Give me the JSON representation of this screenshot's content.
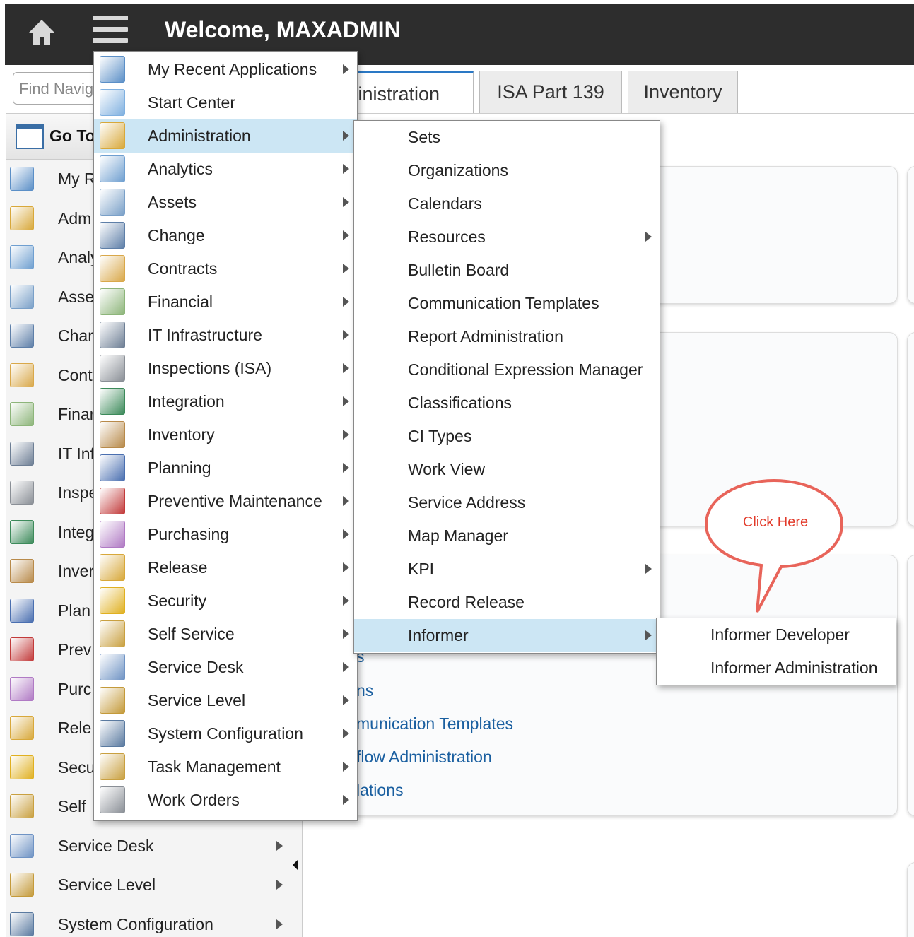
{
  "header": {
    "welcome": "Welcome, MAXADMIN",
    "home_icon": "home-icon",
    "menu_icon": "hamburger-menu-icon"
  },
  "nav": {
    "find_placeholder": "Find Navig",
    "goto_label": "Go To",
    "background_items": [
      {
        "label": "My R",
        "icon": "recent-apps-icon",
        "color": "#5b8fc7"
      },
      {
        "label": "Adm",
        "icon": "administration-icon",
        "color": "#d8a83a"
      },
      {
        "label": "Analy",
        "icon": "analytics-icon",
        "color": "#6f9fd0"
      },
      {
        "label": "Asse",
        "icon": "assets-icon",
        "color": "#7aa0c8"
      },
      {
        "label": "Char",
        "icon": "change-icon",
        "color": "#5e7fa8"
      },
      {
        "label": "Cont",
        "icon": "contracts-icon",
        "color": "#d9a84a"
      },
      {
        "label": "Finar",
        "icon": "financial-icon",
        "color": "#8db57a"
      },
      {
        "label": "IT Inf",
        "icon": "it-infrastructure-icon",
        "color": "#6d7e94"
      },
      {
        "label": "Inspe",
        "icon": "inspections-icon",
        "color": "#8a8f96"
      },
      {
        "label": "Integ",
        "icon": "integration-icon",
        "color": "#3c8a5a"
      },
      {
        "label": "Inver",
        "icon": "inventory-icon",
        "color": "#b88a4a"
      },
      {
        "label": "Plan",
        "icon": "planning-icon",
        "color": "#4a6fb0"
      },
      {
        "label": "Prev",
        "icon": "preventive-maintenance-icon",
        "color": "#c23a3a"
      },
      {
        "label": "Purc",
        "icon": "purchasing-icon",
        "color": "#b07ac4"
      },
      {
        "label": "Rele",
        "icon": "release-icon",
        "color": "#d8a83a"
      },
      {
        "label": "Secu",
        "icon": "security-icon",
        "color": "#e0b020"
      },
      {
        "label": "Self",
        "icon": "self-service-icon",
        "color": "#c9a040"
      },
      {
        "label": "Service Desk",
        "icon": "service-desk-icon",
        "color": "#6f93c4"
      },
      {
        "label": "Service Level",
        "icon": "service-level-icon",
        "color": "#c49a3a"
      },
      {
        "label": "System Configuration",
        "icon": "system-configuration-icon",
        "color": "#5a7aa0"
      }
    ]
  },
  "tabs": [
    {
      "label": "lministration"
    },
    {
      "label": "ISA Part 139"
    },
    {
      "label": "Inventory"
    }
  ],
  "cards": {
    "links": [
      "s",
      "ns",
      "munication Templates",
      "flow Administration",
      "lations"
    ]
  },
  "main_menu": {
    "items": [
      {
        "label": "My Recent Applications",
        "icon": "recent-apps-icon",
        "color": "#5b8fc7",
        "arrow": true
      },
      {
        "label": "Start Center",
        "icon": "start-center-icon",
        "color": "#7fb0e0",
        "arrow": false
      },
      {
        "label": "Administration",
        "icon": "administration-icon",
        "color": "#d8a83a",
        "arrow": true
      },
      {
        "label": "Analytics",
        "icon": "analytics-icon",
        "color": "#6f9fd0",
        "arrow": true
      },
      {
        "label": "Assets",
        "icon": "assets-icon",
        "color": "#7aa0c8",
        "arrow": true
      },
      {
        "label": "Change",
        "icon": "change-icon",
        "color": "#5e7fa8",
        "arrow": true
      },
      {
        "label": "Contracts",
        "icon": "contracts-icon",
        "color": "#d9a84a",
        "arrow": true
      },
      {
        "label": "Financial",
        "icon": "financial-icon",
        "color": "#8db57a",
        "arrow": true
      },
      {
        "label": "IT Infrastructure",
        "icon": "it-infrastructure-icon",
        "color": "#6d7e94",
        "arrow": true
      },
      {
        "label": "Inspections (ISA)",
        "icon": "inspections-icon",
        "color": "#8a8f96",
        "arrow": true
      },
      {
        "label": "Integration",
        "icon": "integration-icon",
        "color": "#3c8a5a",
        "arrow": true
      },
      {
        "label": "Inventory",
        "icon": "inventory-icon",
        "color": "#b88a4a",
        "arrow": true
      },
      {
        "label": "Planning",
        "icon": "planning-icon",
        "color": "#4a6fb0",
        "arrow": true
      },
      {
        "label": "Preventive Maintenance",
        "icon": "preventive-maintenance-icon",
        "color": "#c23a3a",
        "arrow": true
      },
      {
        "label": "Purchasing",
        "icon": "purchasing-icon",
        "color": "#b07ac4",
        "arrow": true
      },
      {
        "label": "Release",
        "icon": "release-icon",
        "color": "#d8a83a",
        "arrow": true
      },
      {
        "label": "Security",
        "icon": "security-icon",
        "color": "#e0b020",
        "arrow": true
      },
      {
        "label": "Self Service",
        "icon": "self-service-icon",
        "color": "#c9a040",
        "arrow": true
      },
      {
        "label": "Service Desk",
        "icon": "service-desk-icon",
        "color": "#6f93c4",
        "arrow": true
      },
      {
        "label": "Service Level",
        "icon": "service-level-icon",
        "color": "#c49a3a",
        "arrow": true
      },
      {
        "label": "System Configuration",
        "icon": "system-configuration-icon",
        "color": "#5a7aa0",
        "arrow": true
      },
      {
        "label": "Task Management",
        "icon": "task-management-icon",
        "color": "#c9a040",
        "arrow": true
      },
      {
        "label": "Work Orders",
        "icon": "work-orders-icon",
        "color": "#8a8f96",
        "arrow": true
      }
    ]
  },
  "admin_menu": {
    "items": [
      {
        "label": "Sets",
        "arrow": false
      },
      {
        "label": "Organizations",
        "arrow": false
      },
      {
        "label": "Calendars",
        "arrow": false
      },
      {
        "label": "Resources",
        "arrow": true
      },
      {
        "label": "Bulletin Board",
        "arrow": false
      },
      {
        "label": "Communication Templates",
        "arrow": false
      },
      {
        "label": "Report Administration",
        "arrow": false
      },
      {
        "label": "Conditional Expression Manager",
        "arrow": false
      },
      {
        "label": "Classifications",
        "arrow": false
      },
      {
        "label": "CI Types",
        "arrow": false
      },
      {
        "label": "Work View",
        "arrow": false
      },
      {
        "label": "Service Address",
        "arrow": false
      },
      {
        "label": "Map Manager",
        "arrow": false
      },
      {
        "label": "KPI",
        "arrow": true
      },
      {
        "label": "Record Release",
        "arrow": false
      },
      {
        "label": "Informer",
        "arrow": true
      }
    ]
  },
  "informer_menu": {
    "items": [
      {
        "label": "Informer Developer"
      },
      {
        "label": "Informer Administration"
      }
    ]
  },
  "callout": {
    "text": "Click Here",
    "color": "#e23a2a"
  },
  "colors": {
    "topbar": "#2d2d2d",
    "highlight": "#cce6f4",
    "link": "#1a5fa0",
    "tab_accent": "#2a78c5"
  }
}
